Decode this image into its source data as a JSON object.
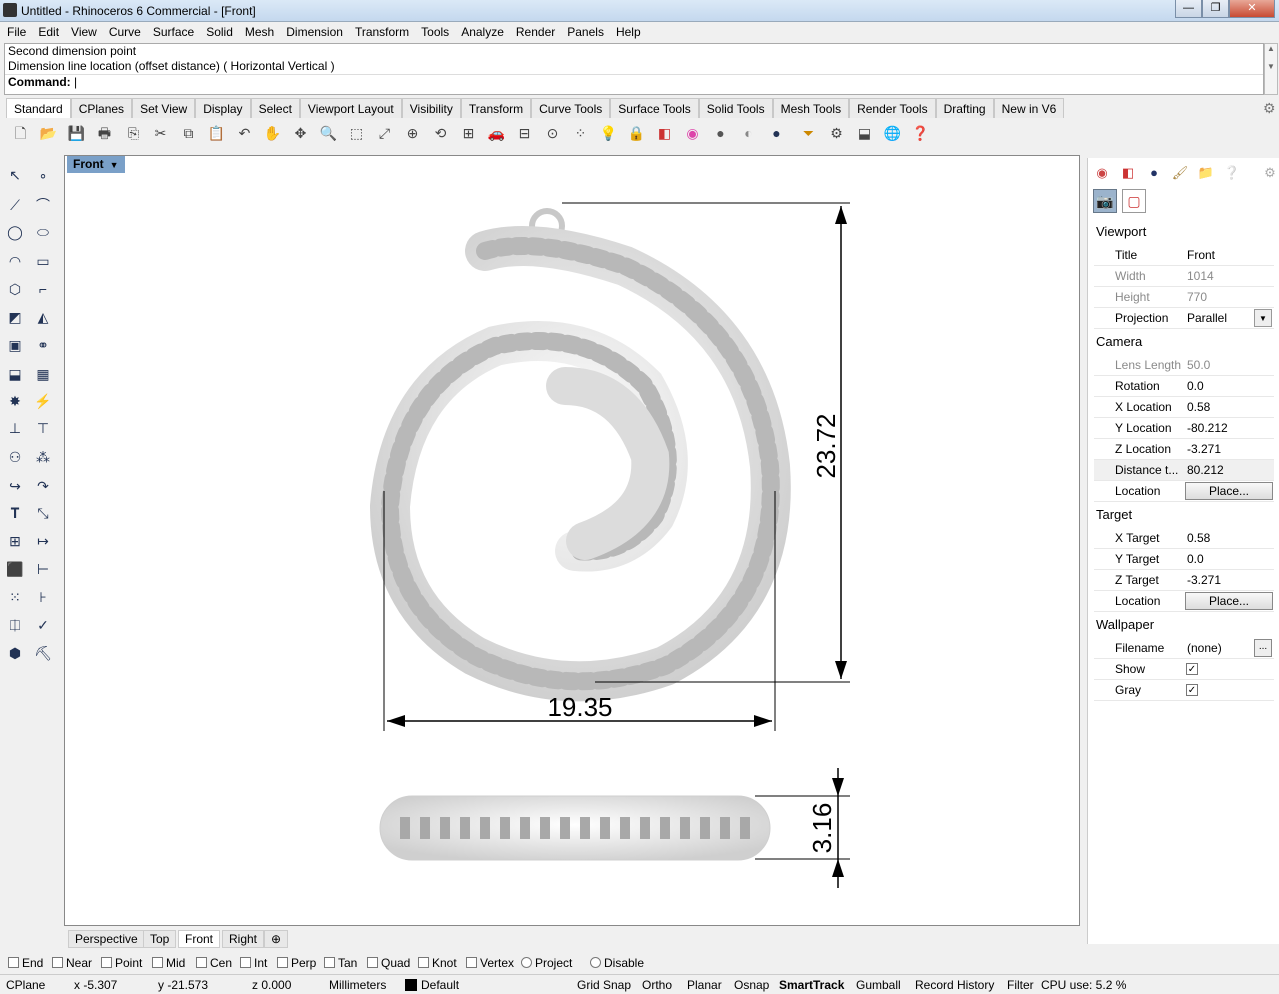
{
  "window": {
    "title": "Untitled - Rhinoceros 6 Commercial - [Front]",
    "minimize": "—",
    "maximize": "❐",
    "close": "✕"
  },
  "menu": [
    "File",
    "Edit",
    "View",
    "Curve",
    "Surface",
    "Solid",
    "Mesh",
    "Dimension",
    "Transform",
    "Tools",
    "Analyze",
    "Render",
    "Panels",
    "Help"
  ],
  "command": {
    "line1": "Second dimension point",
    "line2": "Dimension line location (offset distance) ( Horizontal  Vertical )",
    "prompt": "Command:"
  },
  "toolbar_tabs": [
    "Standard",
    "CPlanes",
    "Set View",
    "Display",
    "Select",
    "Viewport Layout",
    "Visibility",
    "Transform",
    "Curve Tools",
    "Surface Tools",
    "Solid Tools",
    "Mesh Tools",
    "Render Tools",
    "Drafting",
    "New in V6"
  ],
  "viewport": {
    "tab_label": "Front",
    "dims": {
      "height": "23.72",
      "width": "19.35",
      "thickness": "3.16"
    },
    "bottom_tabs": [
      "Perspective",
      "Top",
      "Front",
      "Right"
    ],
    "add_tab": "⊕"
  },
  "panel": {
    "sections": {
      "viewport": "Viewport",
      "camera": "Camera",
      "target": "Target",
      "wallpaper": "Wallpaper"
    },
    "viewport_rows": [
      {
        "k": "Title",
        "v": "Front"
      },
      {
        "k": "Width",
        "v": "1014"
      },
      {
        "k": "Height",
        "v": "770"
      },
      {
        "k": "Projection",
        "v": "Parallel"
      }
    ],
    "camera_rows": [
      {
        "k": "Lens Length",
        "v": "50.0"
      },
      {
        "k": "Rotation",
        "v": "0.0"
      },
      {
        "k": "X Location",
        "v": "0.58"
      },
      {
        "k": "Y Location",
        "v": "-80.212"
      },
      {
        "k": "Z Location",
        "v": "-3.271"
      },
      {
        "k": "Distance t...",
        "v": "80.212"
      },
      {
        "k": "Location",
        "v": "Place..."
      }
    ],
    "target_rows": [
      {
        "k": "X Target",
        "v": "0.58"
      },
      {
        "k": "Y Target",
        "v": "0.0"
      },
      {
        "k": "Z Target",
        "v": "-3.271"
      },
      {
        "k": "Location",
        "v": "Place..."
      }
    ],
    "wallpaper_rows": [
      {
        "k": "Filename",
        "v": "(none)"
      },
      {
        "k": "Show",
        "v": "✓"
      },
      {
        "k": "Gray",
        "v": "✓"
      }
    ],
    "dots": "..."
  },
  "osnaps": [
    "End",
    "Near",
    "Point",
    "Mid",
    "Cen",
    "Int",
    "Perp",
    "Tan",
    "Quad",
    "Knot",
    "Vertex",
    "Project",
    "Disable"
  ],
  "status": {
    "cplane": "CPlane",
    "x": "x -5.307",
    "y": "y -21.573",
    "z": "z 0.000",
    "units": "Millimeters",
    "layer": "Default",
    "toggles": [
      "Grid Snap",
      "Ortho",
      "Planar",
      "Osnap",
      "SmartTrack",
      "Gumball",
      "Record History",
      "Filter"
    ],
    "cpu": "CPU use: 5.2 %"
  }
}
